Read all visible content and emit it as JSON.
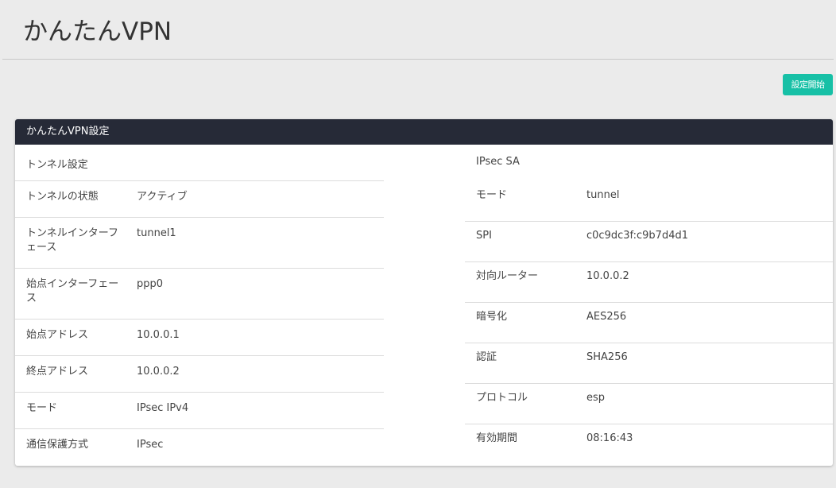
{
  "page": {
    "title": "かんたんVPN",
    "start_button_label": "設定開始"
  },
  "panel": {
    "heading": "かんたんVPN設定",
    "tunnel": {
      "section_label": "トンネル設定",
      "rows": [
        {
          "key": "トンネルの状態",
          "value": "アクティブ"
        },
        {
          "key": "トンネルインターフェース",
          "value": "tunnel1"
        },
        {
          "key": "始点インターフェース",
          "value": "ppp0"
        },
        {
          "key": "始点アドレス",
          "value": "10.0.0.1"
        },
        {
          "key": "終点アドレス",
          "value": "10.0.0.2"
        },
        {
          "key": "モード",
          "value": "IPsec IPv4"
        },
        {
          "key": "通信保護方式",
          "value": "IPsec"
        }
      ]
    },
    "ipsec_sa": {
      "section_label": "IPsec SA",
      "rows": [
        {
          "key": "モード",
          "value": "tunnel"
        },
        {
          "key": "SPI",
          "value": "c0c9dc3f:c9b7d4d1"
        },
        {
          "key": "対向ルーター",
          "value": "10.0.0.2"
        },
        {
          "key": "暗号化",
          "value": "AES256"
        },
        {
          "key": "認証",
          "value": "SHA256"
        },
        {
          "key": "プロトコル",
          "value": "esp"
        },
        {
          "key": "有効期間",
          "value": "08:16:43"
        }
      ]
    }
  },
  "colors": {
    "accent": "#17c0a6",
    "panel_heading_bg": "#262a37",
    "page_bg": "#ebebeb"
  }
}
